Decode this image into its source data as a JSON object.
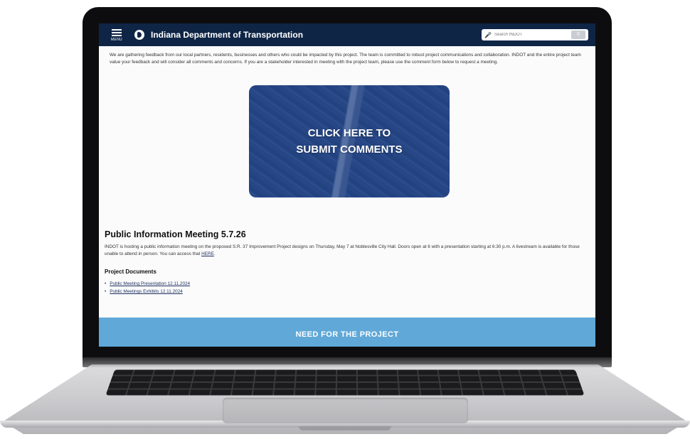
{
  "header": {
    "menu_label": "MENU",
    "site_title": "Indiana Department of Transportation",
    "search_placeholder": "Search INDOT"
  },
  "intro_text": "We are gathering feedback from our local partners, residents, businesses and others who could be impacted by this project. The team is committed to robust project communications and collaboration. INDOT and the entire project team value your feedback and will consider all comments and concerns. If you are a stakeholder interested in meeting with the project team, please use the comment form below to request a meeting.",
  "cta": {
    "line1": "CLICK HERE TO",
    "line2": "SUBMIT COMMENTS"
  },
  "meeting": {
    "title": "Public Information Meeting 5.7.26",
    "body": "INDOT is hosting a public information meeting on the proposed S.R. 37 Improvement Project designs on Thursday, May 7 at Noblesville City Hall. Doors open at 6 with a presentation starting at 6:30 p.m. A livestream is available for those unable to attend in person. You can access that ",
    "link_text": "HERE",
    "body_end": "."
  },
  "documents": {
    "title": "Project Documents",
    "items": [
      {
        "label": "Public Meeting Presentation 12.11.2024"
      },
      {
        "label": "Public Meetings Exhibits 12.11.2024"
      }
    ]
  },
  "band": {
    "label": "NEED FOR THE PROJECT"
  },
  "colors": {
    "header_bg": "#0f2546",
    "band_bg": "#5fa8d8",
    "cta_overlay": "#244586"
  }
}
